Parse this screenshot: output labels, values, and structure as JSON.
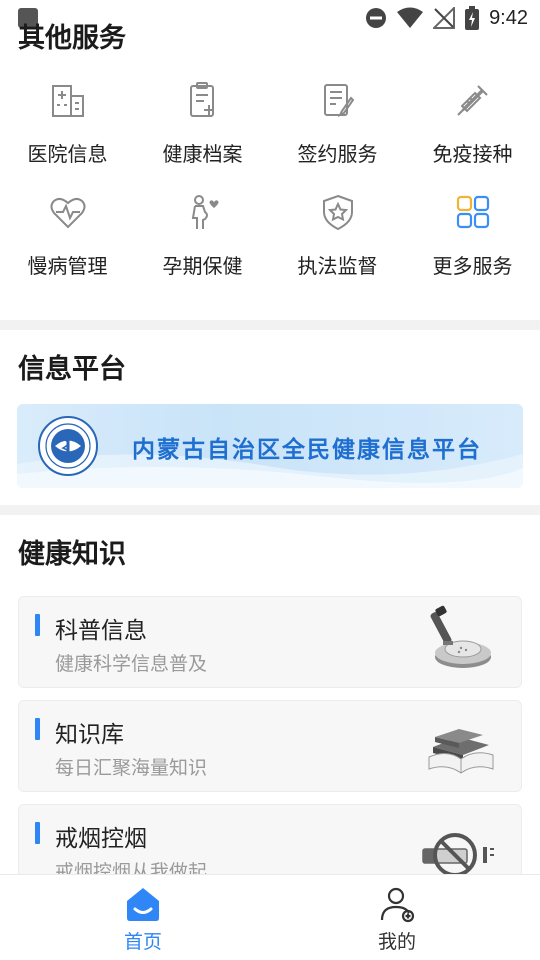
{
  "status_bar": {
    "time": "9:42"
  },
  "services": {
    "title": "其他服务",
    "items": [
      {
        "label": "医院信息",
        "icon": "hospital-icon"
      },
      {
        "label": "健康档案",
        "icon": "health-record-icon"
      },
      {
        "label": "签约服务",
        "icon": "contract-icon"
      },
      {
        "label": "免疫接种",
        "icon": "vaccine-icon"
      },
      {
        "label": "慢病管理",
        "icon": "heart-monitor-icon"
      },
      {
        "label": "孕期保健",
        "icon": "pregnancy-icon"
      },
      {
        "label": "执法监督",
        "icon": "shield-star-icon"
      },
      {
        "label": "更多服务",
        "icon": "grid-icon"
      }
    ]
  },
  "info_platform": {
    "title": "信息平台",
    "banner_text": "内蒙古自治区全民健康信息平台"
  },
  "knowledge": {
    "title": "健康知识",
    "cards": [
      {
        "title": "科普信息",
        "subtitle": "健康科学信息普及",
        "art": "microscope-icon"
      },
      {
        "title": "知识库",
        "subtitle": "每日汇聚海量知识",
        "art": "books-icon"
      },
      {
        "title": "戒烟控烟",
        "subtitle": "戒烟控烟从我做起",
        "art": "no-smoking-icon"
      }
    ]
  },
  "bottom_nav": {
    "home": "首页",
    "mine": "我的"
  },
  "colors": {
    "accent": "#2f86f6",
    "banner_text": "#1f6fd1"
  }
}
